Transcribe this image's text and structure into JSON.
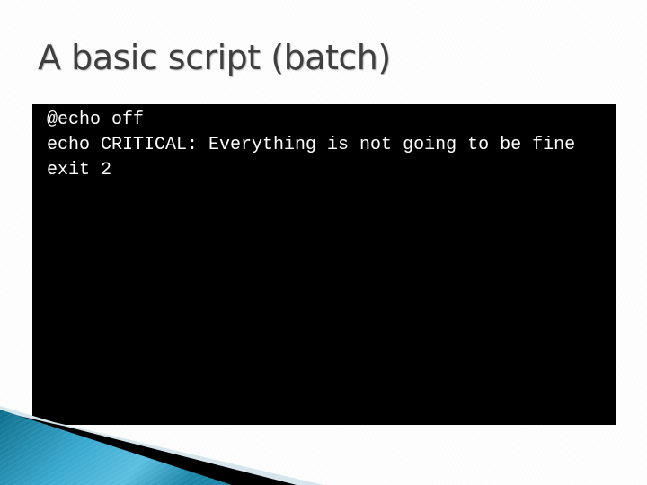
{
  "slide": {
    "title": "A basic script (batch)",
    "code_lines": [
      "@echo off",
      "echo CRITICAL: Everything is not going to be fine",
      "exit 2"
    ]
  },
  "theme": {
    "accent_teal": "#1f8fb3",
    "accent_light": "#d6e6ec",
    "terminal_bg": "#000000",
    "terminal_fg": "#ffffff",
    "title_color": "#3f3f3f"
  }
}
